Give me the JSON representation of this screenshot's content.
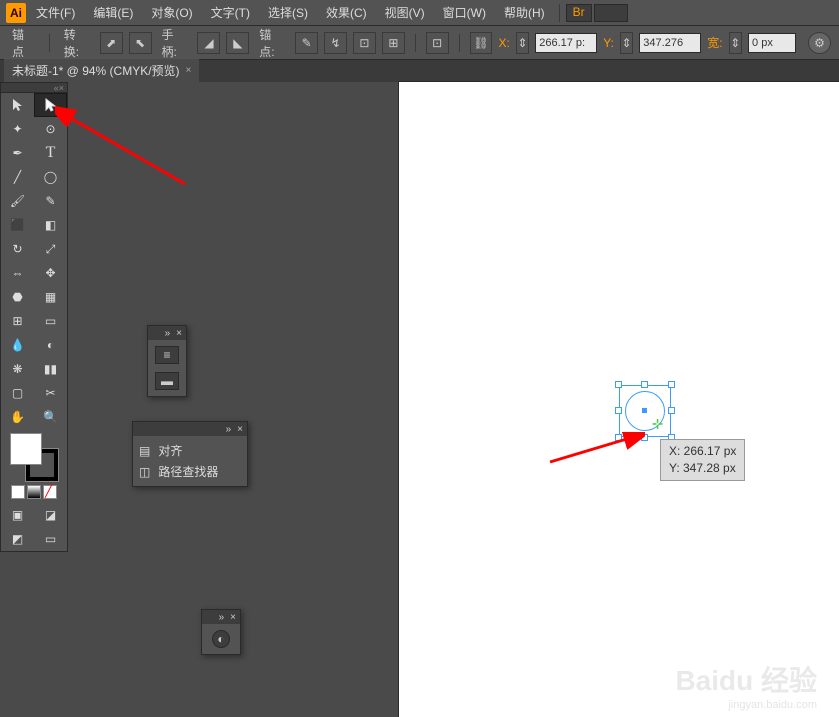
{
  "app": {
    "logo": "Ai"
  },
  "menu": {
    "file": "文件(F)",
    "edit": "编辑(E)",
    "object": "对象(O)",
    "type": "文字(T)",
    "select": "选择(S)",
    "effect": "效果(C)",
    "view": "视图(V)",
    "window": "窗口(W)",
    "help": "帮助(H)"
  },
  "controlbar": {
    "anchor": "锚点",
    "convert": "转换:",
    "handle": "手柄:",
    "anchors": "锚点:",
    "x_label": "X:",
    "x_value": "266.17 p:",
    "y_label": "Y:",
    "y_value": "347.276",
    "w_label": "宽:",
    "w_value": "0 px"
  },
  "tab": {
    "title": "未标题-1* @ 94% (CMYK/预览)"
  },
  "panels": {
    "align": "对齐",
    "pathfinder": "路径查找器"
  },
  "tooltip": {
    "x": "X: 266.17 px",
    "y": "Y: 347.28 px"
  },
  "watermark": {
    "main": "Baidu 经验",
    "sub": "jingyan.baidu.com"
  }
}
